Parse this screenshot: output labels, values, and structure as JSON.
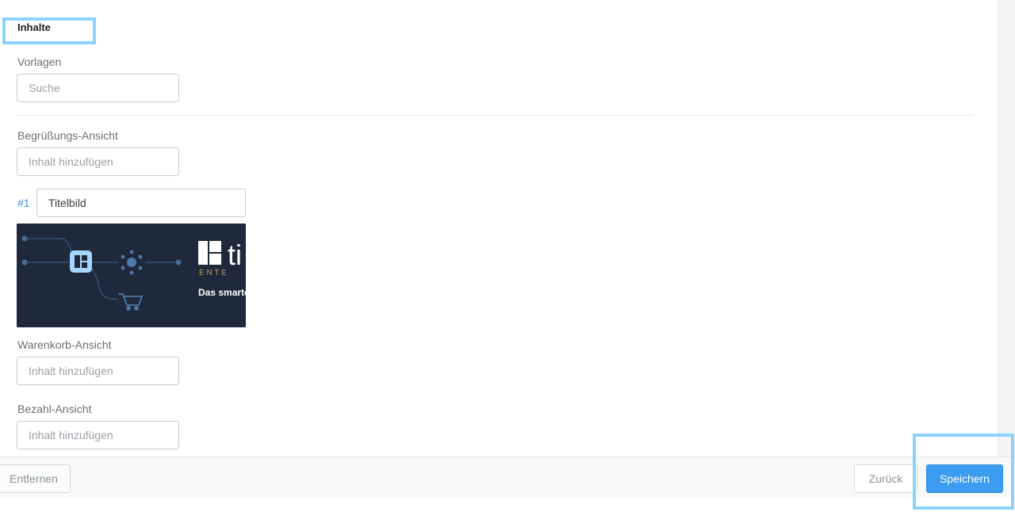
{
  "section": {
    "title": "Inhalte"
  },
  "templates": {
    "label": "Vorlagen",
    "search_placeholder": "Suche"
  },
  "welcome_view": {
    "label": "Begrüßungs-Ansicht",
    "add_placeholder": "Inhalt hinzufügen",
    "items": [
      {
        "number": "#1",
        "title": "Titelbild",
        "image_text": {
          "brand_mark": "ti",
          "subtitle": "E N T E",
          "tagline": "Das smarte"
        }
      }
    ]
  },
  "cart_view": {
    "label": "Warenkorb-Ansicht",
    "add_placeholder": "Inhalt hinzufügen"
  },
  "payment_view": {
    "label": "Bezahl-Ansicht",
    "add_placeholder": "Inhalt hinzufügen"
  },
  "footer": {
    "remove_label": "Entfernen",
    "back_label": "Zurück",
    "save_label": "Speichern"
  },
  "colors": {
    "accent": "#3b9cf0",
    "highlight": "#8bd3fb",
    "thumbnail_bg": "#1e293b",
    "brand_gold": "#c79a5a"
  }
}
